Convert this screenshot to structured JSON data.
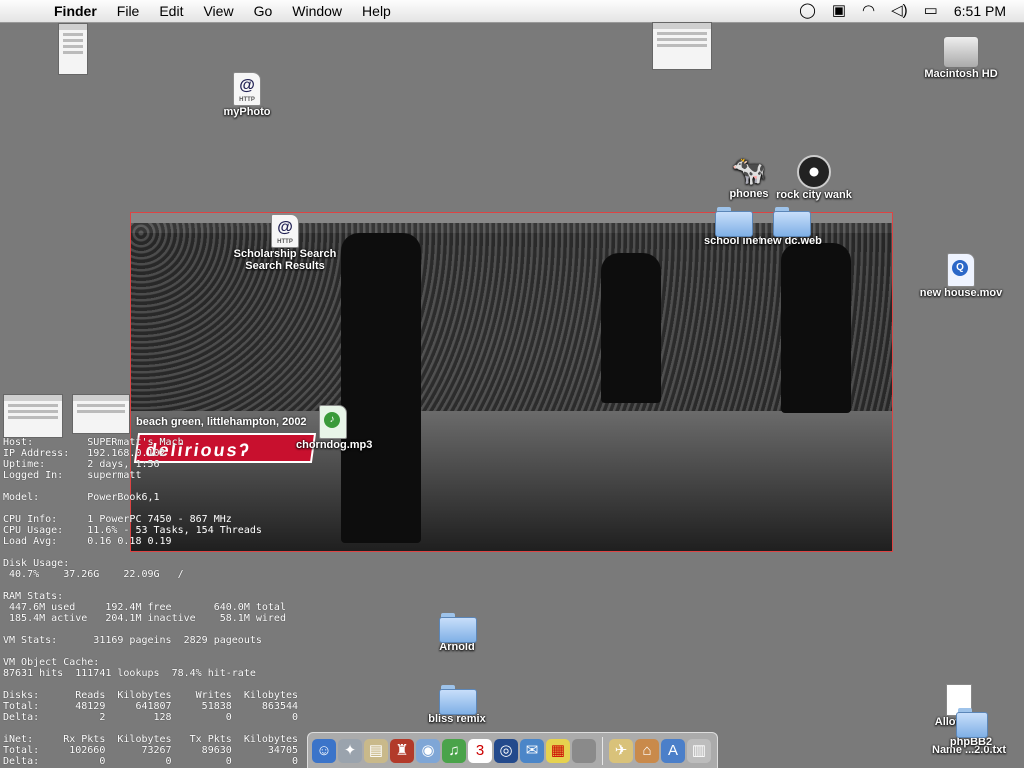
{
  "menubar": {
    "apple": "",
    "items": [
      "Finder",
      "File",
      "Edit",
      "View",
      "Go",
      "Window",
      "Help"
    ],
    "clock": "6:51 PM",
    "extras": [
      "◯",
      "▣",
      "◠",
      "◁)",
      "▭"
    ]
  },
  "desktop_icons": {
    "macintosh_hd": "Macintosh HD",
    "myphoto": "myPhoto",
    "phones": "phones",
    "rock_city_wank": "rock city wank",
    "school_inet": "school inet",
    "new_dc_web": "new dc.web",
    "scholarship": "Scholarship Search\nSearch Results",
    "new_house_mov": "new house.mov",
    "chorndog": "chorndog.mp3",
    "arnold": "Arnold",
    "bliss_remix": "bliss remix",
    "allow_bar": "Allow...ar",
    "name_txt": "Name ...2.0.txt",
    "phpbb2": "phpBB2"
  },
  "photo": {
    "caption": "beach green, littlehampton, 2002",
    "banner": "deliriousʔ"
  },
  "stats": "Host:         SUPERmatt's Mach\nIP Address:   192.168.0.102\nUptime:       2 days, 1:56\nLogged In:    supermatt\n\nModel:        PowerBook6,1\n\nCPU Info:     1 PowerPC 7450 - 867 MHz\nCPU Usage:    11.6% - 53 Tasks, 154 Threads\nLoad Avg:     0.16 0.18 0.19\n\nDisk Usage:\n 40.7%    37.26G    22.09G   /\n\nRAM Stats:\n 447.6M used     192.4M free       640.0M total\n 185.4M active   204.1M inactive    58.1M wired\n\nVM Stats:      31169 pageins  2829 pageouts\n\nVM Object Cache:\n87631 hits  111741 lookups  78.4% hit-rate\n\nDisks:      Reads  Kilobytes    Writes  Kilobytes\nTotal:      48129     641807     51838     863544\nDelta:          2        128         0          0\n\niNet:     Rx Pkts  Kilobytes   Tx Pkts  Kilobytes\nTotal:     102660      73267     89630      34705\nDelta:          0          0         0          0",
  "dock": {
    "apps": [
      {
        "name": "finder",
        "glyph": "☺",
        "color": "#3b74c9"
      },
      {
        "name": "safari",
        "glyph": "✦",
        "color": "#9aa3ad"
      },
      {
        "name": "preview",
        "glyph": "▤",
        "color": "#c9b98a"
      },
      {
        "name": "camino",
        "glyph": "♜",
        "color": "#b23a2a"
      },
      {
        "name": "itunes-cd",
        "glyph": "◉",
        "color": "#7fa6d6"
      },
      {
        "name": "itunes",
        "glyph": "♫",
        "color": "#4aa34a"
      },
      {
        "name": "ical",
        "glyph": "3",
        "color": "#ffffff"
      },
      {
        "name": "quicktime",
        "glyph": "◎",
        "color": "#234a8c"
      },
      {
        "name": "mail",
        "glyph": "✉",
        "color": "#4b86c8"
      },
      {
        "name": "stickies",
        "glyph": "▦",
        "color": "#e6d24f"
      },
      {
        "name": "system-prefs",
        "glyph": "",
        "color": "#8a8a8a"
      }
    ],
    "docs": [
      {
        "name": "plane",
        "glyph": "✈",
        "color": "#d9c27a"
      },
      {
        "name": "home",
        "glyph": "⌂",
        "color": "#c98a4b"
      },
      {
        "name": "applications",
        "glyph": "A",
        "color": "#4b7fc9"
      },
      {
        "name": "trash",
        "glyph": "▥",
        "color": "#bdbdbd"
      }
    ]
  }
}
